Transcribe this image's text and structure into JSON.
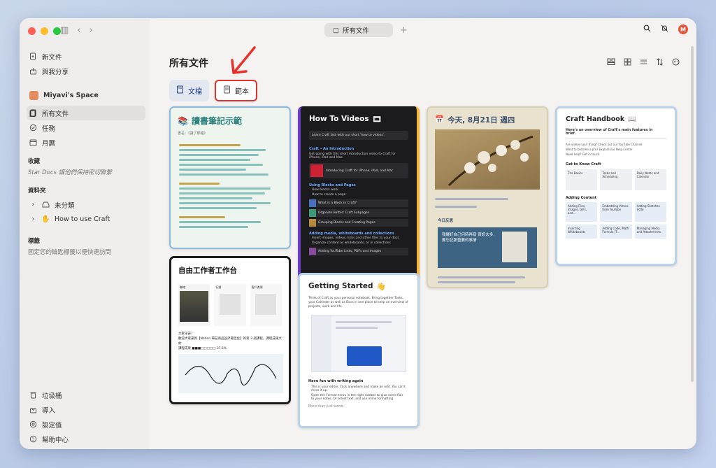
{
  "window": {
    "tab_label": "所有文件"
  },
  "sidebar": {
    "top_items": [
      {
        "label": "新文件"
      },
      {
        "label": "與我分享"
      }
    ],
    "space_name": "Miyavi's Space",
    "space_items": [
      {
        "label": "所有文件"
      },
      {
        "label": "任務"
      },
      {
        "label": "月曆"
      }
    ],
    "favorites_label": "收藏",
    "favorites_hint": "Star Docs 讓他們保持密切聯繫",
    "folders_label": "資料夾",
    "folders": [
      {
        "label": "未分類"
      },
      {
        "label": "How to use Craft"
      }
    ],
    "tags_label": "標籤",
    "tags_hint": "固定您的鑰匙標籤以便快速訪問",
    "bottom_items": [
      {
        "label": "垃圾桶"
      },
      {
        "label": "導入"
      },
      {
        "label": "設定值"
      },
      {
        "label": "幫助中心"
      }
    ]
  },
  "main": {
    "title": "所有文件",
    "seg_docs": "文檔",
    "seg_templates": "範本"
  },
  "cards": {
    "reading_notes": {
      "title": "讀書筆記示範",
      "sub": "書名：《讀了那種》"
    },
    "how_to_videos": {
      "title": "How To Videos",
      "intro": "Learn Craft fast with our short 'how to videos'.",
      "section1": "Craft – An Introduction",
      "section1_text": "Get going with this short introduction video to Craft for iPhone, iPad and Mac.",
      "video1": "Introducing Craft for iPhone, iPad, and Mac",
      "section2": "Using Blocks and Pages",
      "bullet1": "How blocks work",
      "bullet2": "How to create a page",
      "link1": "What is a Block in Craft?",
      "link2": "Organize Better: Craft Subpages",
      "link3": "Grouping Blocks and Creating Pages",
      "section3": "Adding media, whiteboards and collections",
      "bullet3": "Insert images, videos, links and other files to your docs",
      "bullet4": "Organize content as whiteboards, or in collections",
      "link4": "Adding YouTube Links, PDFs and Images"
    },
    "journal": {
      "title": "今天, 8月21日 週四",
      "sub": "今日反思",
      "note": "我擬好自己何時再寫 資訊太多，要忘記那重要的事情"
    },
    "handbook": {
      "title": "Craft Handbook",
      "overview": "Here's an overview of Craft's main features in brief.",
      "line1": "Are videos your thing? Check out our YouTube Channel",
      "line2": "Want to become a pro? Explore our Help Center",
      "line3": "Need help? Get in touch",
      "section1": "Get to Know Craft",
      "tiles1": [
        "The Basics",
        "Tasks and Scheduling",
        "Daily Notes and Calendar"
      ],
      "section2": "Adding Content",
      "tiles2": [
        "Adding Files, Images, GIFs, and...",
        "Embedding Videos from YouTube",
        "Adding Sketches (iOS)",
        "Inserting Whiteboards",
        "Adding Code, Math Formula (T...",
        "Managing Media and Attachments"
      ]
    },
    "freelancer": {
      "title": "自由工作者工作台",
      "col1": "聯絡",
      "col2": "行銷",
      "col3": "客戶委傳",
      "text1": "大家早安！",
      "text2": "歡迎大家來到【Notion 筆記商品設計最佳化】的第 3 週課程，課程成果大約",
      "text3": "課程成果 ■■■□□□□□ 37.5%"
    },
    "getting_started": {
      "title": "Getting Started",
      "intro": "Think of Craft as your personal notebook. Bring together Tasks, your Calendar as well as Docs in one place to keep an overview of projects, work and life.",
      "section": "Have fun with writing again",
      "bullet1": "This is your editor. Click anywhere and make an edit. You can't mess it up.",
      "bullet2": "Open the Format menu in the right sidebar to give some flair to your notes. Or select text, and use inline formatting.",
      "more": "More than just words"
    }
  },
  "colors": {
    "accent_red": "#e8312b",
    "seg_active": "#1a3d8f"
  }
}
